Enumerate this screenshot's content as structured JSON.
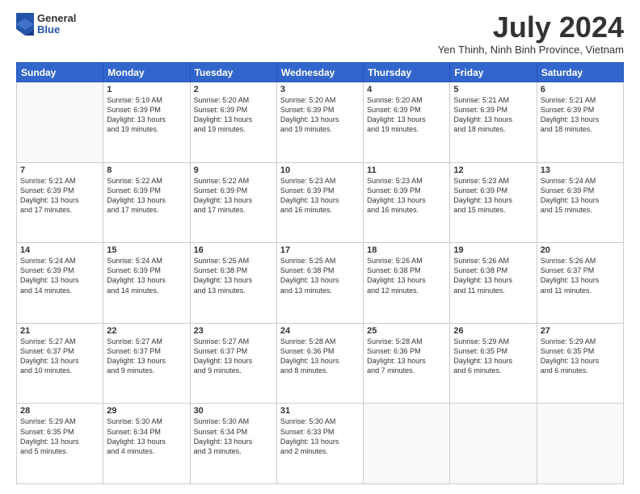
{
  "header": {
    "logo": {
      "line1": "General",
      "line2": "Blue"
    },
    "month_title": "July 2024",
    "subtitle": "Yen Thinh, Ninh Binh Province, Vietnam"
  },
  "days_of_week": [
    "Sunday",
    "Monday",
    "Tuesday",
    "Wednesday",
    "Thursday",
    "Friday",
    "Saturday"
  ],
  "weeks": [
    [
      {
        "day": "",
        "info": ""
      },
      {
        "day": "1",
        "info": "Sunrise: 5:19 AM\nSunset: 6:39 PM\nDaylight: 13 hours\nand 19 minutes."
      },
      {
        "day": "2",
        "info": "Sunrise: 5:20 AM\nSunset: 6:39 PM\nDaylight: 13 hours\nand 19 minutes."
      },
      {
        "day": "3",
        "info": "Sunrise: 5:20 AM\nSunset: 6:39 PM\nDaylight: 13 hours\nand 19 minutes."
      },
      {
        "day": "4",
        "info": "Sunrise: 5:20 AM\nSunset: 6:39 PM\nDaylight: 13 hours\nand 19 minutes."
      },
      {
        "day": "5",
        "info": "Sunrise: 5:21 AM\nSunset: 6:39 PM\nDaylight: 13 hours\nand 18 minutes."
      },
      {
        "day": "6",
        "info": "Sunrise: 5:21 AM\nSunset: 6:39 PM\nDaylight: 13 hours\nand 18 minutes."
      }
    ],
    [
      {
        "day": "7",
        "info": "Sunrise: 5:21 AM\nSunset: 6:39 PM\nDaylight: 13 hours\nand 17 minutes."
      },
      {
        "day": "8",
        "info": "Sunrise: 5:22 AM\nSunset: 6:39 PM\nDaylight: 13 hours\nand 17 minutes."
      },
      {
        "day": "9",
        "info": "Sunrise: 5:22 AM\nSunset: 6:39 PM\nDaylight: 13 hours\nand 17 minutes."
      },
      {
        "day": "10",
        "info": "Sunrise: 5:23 AM\nSunset: 6:39 PM\nDaylight: 13 hours\nand 16 minutes."
      },
      {
        "day": "11",
        "info": "Sunrise: 5:23 AM\nSunset: 6:39 PM\nDaylight: 13 hours\nand 16 minutes."
      },
      {
        "day": "12",
        "info": "Sunrise: 5:23 AM\nSunset: 6:39 PM\nDaylight: 13 hours\nand 15 minutes."
      },
      {
        "day": "13",
        "info": "Sunrise: 5:24 AM\nSunset: 6:39 PM\nDaylight: 13 hours\nand 15 minutes."
      }
    ],
    [
      {
        "day": "14",
        "info": "Sunrise: 5:24 AM\nSunset: 6:39 PM\nDaylight: 13 hours\nand 14 minutes."
      },
      {
        "day": "15",
        "info": "Sunrise: 5:24 AM\nSunset: 6:39 PM\nDaylight: 13 hours\nand 14 minutes."
      },
      {
        "day": "16",
        "info": "Sunrise: 5:25 AM\nSunset: 6:38 PM\nDaylight: 13 hours\nand 13 minutes."
      },
      {
        "day": "17",
        "info": "Sunrise: 5:25 AM\nSunset: 6:38 PM\nDaylight: 13 hours\nand 13 minutes."
      },
      {
        "day": "18",
        "info": "Sunrise: 5:26 AM\nSunset: 6:38 PM\nDaylight: 13 hours\nand 12 minutes."
      },
      {
        "day": "19",
        "info": "Sunrise: 5:26 AM\nSunset: 6:38 PM\nDaylight: 13 hours\nand 11 minutes."
      },
      {
        "day": "20",
        "info": "Sunrise: 5:26 AM\nSunset: 6:37 PM\nDaylight: 13 hours\nand 11 minutes."
      }
    ],
    [
      {
        "day": "21",
        "info": "Sunrise: 5:27 AM\nSunset: 6:37 PM\nDaylight: 13 hours\nand 10 minutes."
      },
      {
        "day": "22",
        "info": "Sunrise: 5:27 AM\nSunset: 6:37 PM\nDaylight: 13 hours\nand 9 minutes."
      },
      {
        "day": "23",
        "info": "Sunrise: 5:27 AM\nSunset: 6:37 PM\nDaylight: 13 hours\nand 9 minutes."
      },
      {
        "day": "24",
        "info": "Sunrise: 5:28 AM\nSunset: 6:36 PM\nDaylight: 13 hours\nand 8 minutes."
      },
      {
        "day": "25",
        "info": "Sunrise: 5:28 AM\nSunset: 6:36 PM\nDaylight: 13 hours\nand 7 minutes."
      },
      {
        "day": "26",
        "info": "Sunrise: 5:29 AM\nSunset: 6:35 PM\nDaylight: 13 hours\nand 6 minutes."
      },
      {
        "day": "27",
        "info": "Sunrise: 5:29 AM\nSunset: 6:35 PM\nDaylight: 13 hours\nand 6 minutes."
      }
    ],
    [
      {
        "day": "28",
        "info": "Sunrise: 5:29 AM\nSunset: 6:35 PM\nDaylight: 13 hours\nand 5 minutes."
      },
      {
        "day": "29",
        "info": "Sunrise: 5:30 AM\nSunset: 6:34 PM\nDaylight: 13 hours\nand 4 minutes."
      },
      {
        "day": "30",
        "info": "Sunrise: 5:30 AM\nSunset: 6:34 PM\nDaylight: 13 hours\nand 3 minutes."
      },
      {
        "day": "31",
        "info": "Sunrise: 5:30 AM\nSunset: 6:33 PM\nDaylight: 13 hours\nand 2 minutes."
      },
      {
        "day": "",
        "info": ""
      },
      {
        "day": "",
        "info": ""
      },
      {
        "day": "",
        "info": ""
      }
    ]
  ]
}
